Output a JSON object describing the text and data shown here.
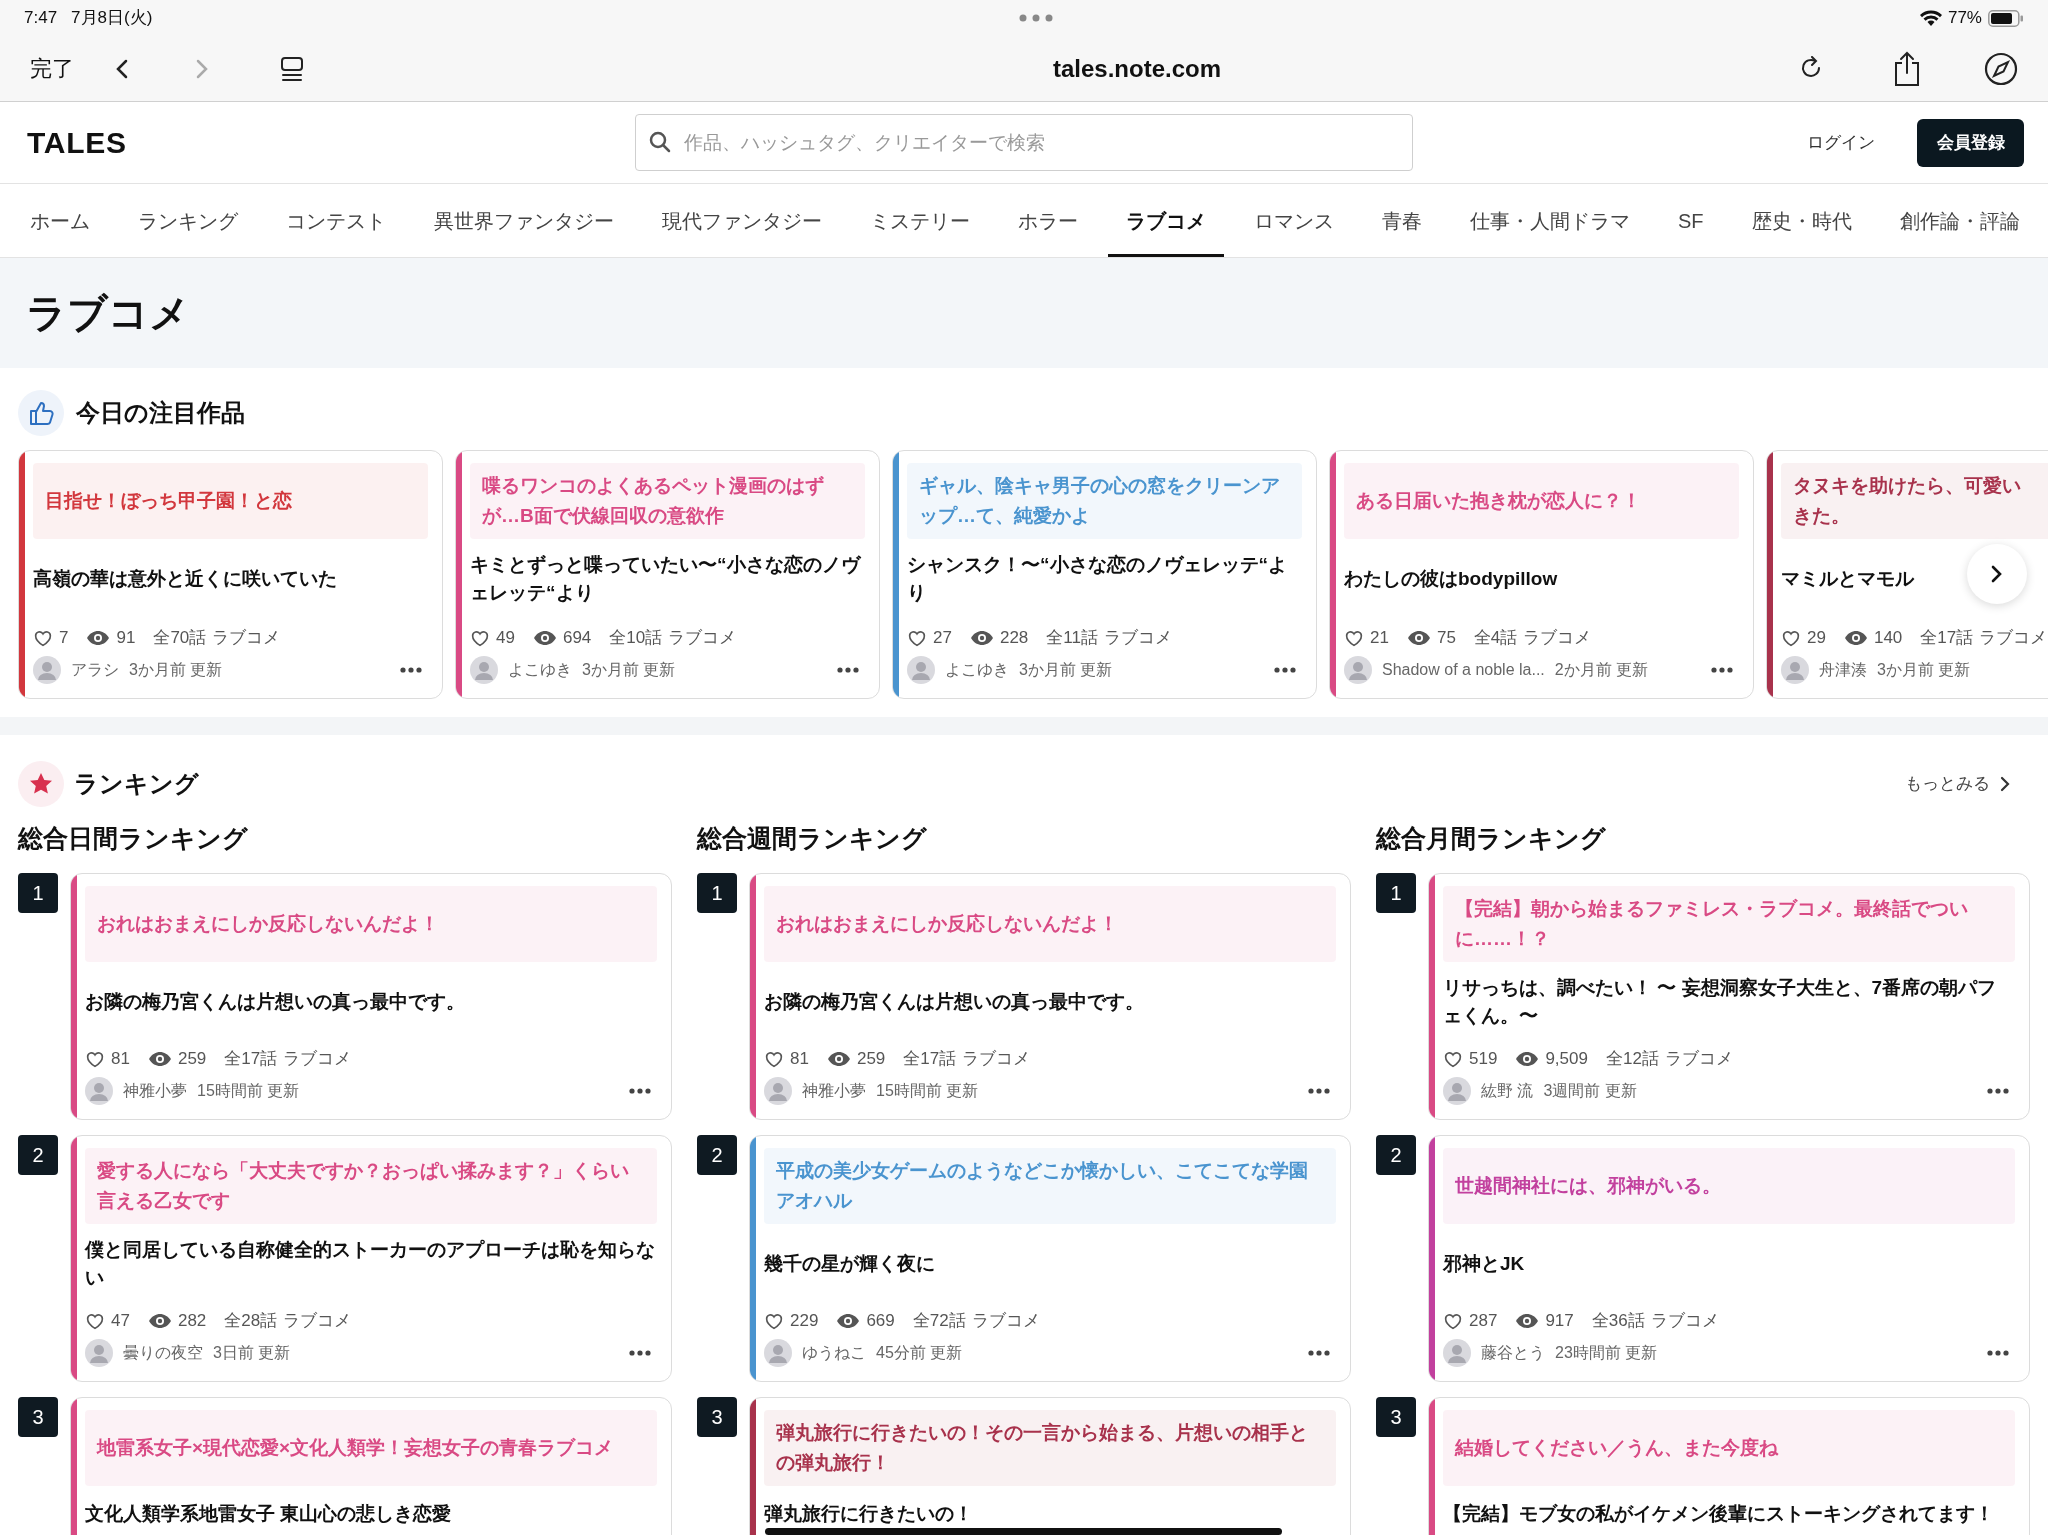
{
  "status_bar": {
    "time": "7:47",
    "date": "7月8日(火)",
    "battery": "77%"
  },
  "browser": {
    "done": "完了",
    "nav_buttons": [
      {
        "kind": "back",
        "disabled": false
      },
      {
        "kind": "forward",
        "disabled": true
      }
    ],
    "url": "tales.note.com"
  },
  "header": {
    "logo": "TALES",
    "search": {
      "placeholder": "作品、ハッシュタグ、クリエイターで検索"
    },
    "login": "ログイン",
    "signup": "会員登録"
  },
  "tabs": [
    {
      "label": "ホーム",
      "selected": false
    },
    {
      "label": "ランキング",
      "selected": false
    },
    {
      "label": "コンテスト",
      "selected": false
    },
    {
      "label": "異世界ファンタジー",
      "selected": false
    },
    {
      "label": "現代ファンタジー",
      "selected": false
    },
    {
      "label": "ミステリー",
      "selected": false
    },
    {
      "label": "ホラー",
      "selected": false
    },
    {
      "label": "ラブコメ",
      "selected": true
    },
    {
      "label": "ロマンス",
      "selected": false
    },
    {
      "label": "青春",
      "selected": false
    },
    {
      "label": "仕事・人間ドラマ",
      "selected": false
    },
    {
      "label": "SF",
      "selected": false
    },
    {
      "label": "歴史・時代",
      "selected": false
    },
    {
      "label": "創作論・評論",
      "selected": false
    }
  ],
  "page_title": "ラブコメ",
  "featured": {
    "title": "今日の注目作品",
    "cards": [
      {
        "tag": "目指せ！ぼっち甲子園！と恋",
        "title": "高嶺の華は意外と近くに咲いていた",
        "likes": "7",
        "views": "91",
        "episodes": "全70話",
        "genre": "ラブコメ",
        "author": "アラシ",
        "updated": "3か月前 更新",
        "color": "#d2373d"
      },
      {
        "tag": "喋るワンコのよくあるペット漫画のはずが…B面で伏線回収の意欲作",
        "title": "キミとずっと喋っていたい〜“小さな恋のノヴェレッテ“より",
        "likes": "49",
        "views": "694",
        "episodes": "全10話",
        "genre": "ラブコメ",
        "author": "よこゆき",
        "updated": "3か月前 更新",
        "color": "#d94a84"
      },
      {
        "tag": "ギャル、陰キャ男子の心の窓をクリーンアップ…て、純愛かよ",
        "title": "シャンスク！〜“小さな恋のノヴェレッテ“より",
        "likes": "27",
        "views": "228",
        "episodes": "全11話",
        "genre": "ラブコメ",
        "author": "よこゆき",
        "updated": "3か月前 更新",
        "color": "#4a94cf"
      },
      {
        "tag": "ある日届いた抱き枕が恋人に？！",
        "title": "わたしの彼はbodypillow",
        "likes": "21",
        "views": "75",
        "episodes": "全4話",
        "genre": "ラブコメ",
        "author": "Shadow of a noble la...",
        "updated": "2か月前 更新",
        "color": "#d94a84"
      },
      {
        "tag_lines": [
          "タヌキを助けたら、可愛い",
          "きた。"
        ],
        "title": "マミルとマモル",
        "likes": "29",
        "views": "140",
        "episodes": "全17話",
        "genre": "ラブコメ",
        "author": "舟津湊",
        "updated": "3か月前 更新",
        "color": "#a8324c"
      }
    ]
  },
  "ranking": {
    "title": "ランキング",
    "more": "もっとみる",
    "columns": [
      {
        "title": "総合日間ランキング",
        "items": [
          {
            "rank": "1",
            "tag": "おれはおまえにしか反応しないんだよ！",
            "title": "お隣の梅乃宮くんは片想いの真っ最中です。",
            "likes": "81",
            "views": "259",
            "episodes": "全17話",
            "genre": "ラブコメ",
            "author": "神雅小夢",
            "updated": "15時間前 更新",
            "color": "#d94a84"
          },
          {
            "rank": "2",
            "tag": "愛する人になら「大丈夫ですか？おっぱい揉みます？」くらい言える乙女です",
            "title": "僕と同居している自称健全的ストーカーのアプローチは恥を知らない",
            "likes": "47",
            "views": "282",
            "episodes": "全28話",
            "genre": "ラブコメ",
            "author": "曇りの夜空",
            "updated": "3日前 更新",
            "color": "#d94a84"
          },
          {
            "rank": "3",
            "tag": "地雷系女子×現代恋愛×文化人類学！妄想女子の青春ラブコメ",
            "title": "文化人類学系地雷女子 東山心の悲しき恋愛",
            "color": "#d94a84"
          }
        ]
      },
      {
        "title": "総合週間ランキング",
        "items": [
          {
            "rank": "1",
            "tag": "おれはおまえにしか反応しないんだよ！",
            "title": "お隣の梅乃宮くんは片想いの真っ最中です。",
            "likes": "81",
            "views": "259",
            "episodes": "全17話",
            "genre": "ラブコメ",
            "author": "神雅小夢",
            "updated": "15時間前 更新",
            "color": "#d94a84"
          },
          {
            "rank": "2",
            "tag": "平成の美少女ゲームのようなどこか懐かしい、こてこてな学園アオハル",
            "title": "幾千の星が輝く夜に",
            "likes": "229",
            "views": "669",
            "episodes": "全72話",
            "genre": "ラブコメ",
            "author": "ゆうねこ",
            "updated": "45分前 更新",
            "color": "#4a94cf"
          },
          {
            "rank": "3",
            "tag": "弾丸旅行に行きたいの！その一言から始まる、片想いの相手との弾丸旅行！",
            "title": "弾丸旅行に行きたいの！",
            "color": "#a8324c"
          }
        ]
      },
      {
        "title": "総合月間ランキング",
        "items": [
          {
            "rank": "1",
            "tag": "【完結】朝から始まるファミレス・ラブコメ。最終話でついに……！？",
            "title": "リサっちは、調べたい！ 〜 妄想洞察女子大生と、7番席の朝パフェくん。〜",
            "likes": "519",
            "views": "9,509",
            "episodes": "全12話",
            "genre": "ラブコメ",
            "author": "紘野 流",
            "updated": "3週間前 更新",
            "color": "#d94a84"
          },
          {
            "rank": "2",
            "tag": "世越間神社には、邪神がいる。",
            "title": "邪神とJK",
            "likes": "287",
            "views": "917",
            "episodes": "全36話",
            "genre": "ラブコメ",
            "author": "藤谷とう",
            "updated": "23時間前 更新",
            "color": "#c2409e"
          },
          {
            "rank": "3",
            "tag": "結婚してください／うん、また今度ね",
            "title": "【完結】モブ女の私がイケメン後輩にストーキングされてます！",
            "color": "#d94a84"
          }
        ]
      }
    ]
  }
}
